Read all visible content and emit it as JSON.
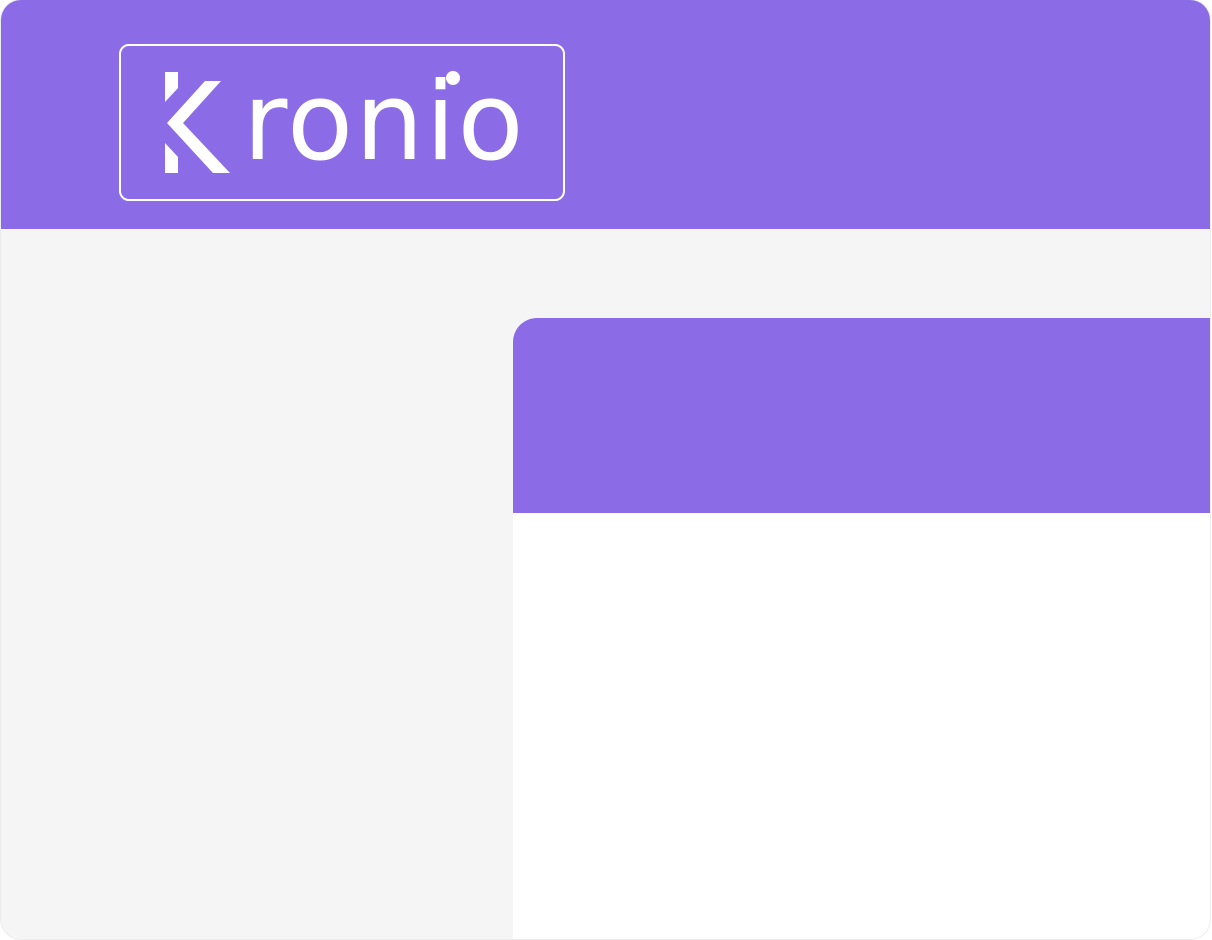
{
  "app": {
    "logo": {
      "icon": "k-logo-icon",
      "text": "ronio"
    }
  },
  "colors": {
    "brand": "#8b6ce6",
    "background": "#f5f5f5",
    "panel": "#ffffff"
  }
}
